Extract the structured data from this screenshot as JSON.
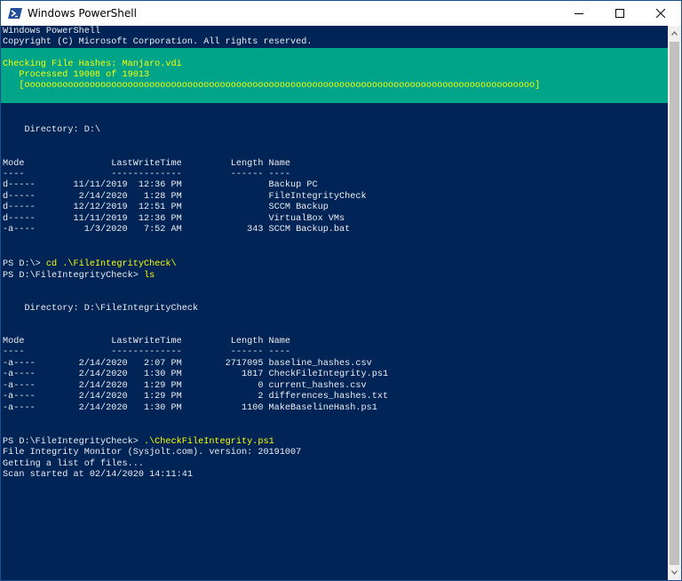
{
  "window": {
    "title": "Windows PowerShell",
    "app_icon": "powershell-icon",
    "controls": [
      "minimize-icon",
      "maximize-icon",
      "close-icon"
    ]
  },
  "colors": {
    "console_bg": "#012456",
    "console_fg": "#eeedf0",
    "progress_bg": "#00a489",
    "progress_fg": "#ffff00",
    "command_fg": "#ffff00"
  },
  "console": {
    "banner": [
      "Windows PowerShell",
      "Copyright (C) Microsoft Corporation. All rights reserved."
    ],
    "progress": {
      "activity": "Checking File Hashes: Manjaro.vdi",
      "status": "   Processed 19008 of 19013",
      "bar": "   [oooooooooooooooooooooooooooooooooooooooooooooooooooooooooooooooooooooooooooooooooooooooooooooo]"
    },
    "listing1": {
      "directory": "    Directory: D:\\",
      "header": "Mode                LastWriteTime         Length Name",
      "underline": "----                -------------         ------ ----",
      "rows": [
        "d-----       11/11/2019  12:36 PM                Backup PC",
        "d-----        2/14/2020   1:28 PM                FileIntegrityCheck",
        "d-----       12/12/2019  12:51 PM                SCCM Backup",
        "d-----       11/11/2019  12:36 PM                VirtualBox VMs",
        "-a----         1/3/2020   7:52 AM            343 SCCM Backup.bat"
      ]
    },
    "cmd1": {
      "prompt": "PS D:\\> ",
      "command": "cd .\\FileIntegrityCheck\\"
    },
    "cmd2": {
      "prompt": "PS D:\\FileIntegrityCheck> ",
      "command": "ls"
    },
    "listing2": {
      "directory": "    Directory: D:\\FileIntegrityCheck",
      "header": "Mode                LastWriteTime         Length Name",
      "underline": "----                -------------         ------ ----",
      "rows": [
        "-a----        2/14/2020   2:07 PM        2717095 baseline_hashes.csv",
        "-a----        2/14/2020   1:30 PM           1817 CheckFileIntegrity.ps1",
        "-a----        2/14/2020   1:29 PM              0 current_hashes.csv",
        "-a----        2/14/2020   1:29 PM              2 differences_hashes.txt",
        "-a----        2/14/2020   1:30 PM           1100 MakeBaselineHash.ps1"
      ]
    },
    "cmd3": {
      "prompt": "PS D:\\FileIntegrityCheck> ",
      "command": ".\\CheckFileIntegrity.ps1"
    },
    "output": [
      "File Integrity Monitor (Sysjolt.com). version: 20191007",
      "Getting a list of files...",
      "Scan started at 02/14/2020 14:11:41"
    ]
  }
}
